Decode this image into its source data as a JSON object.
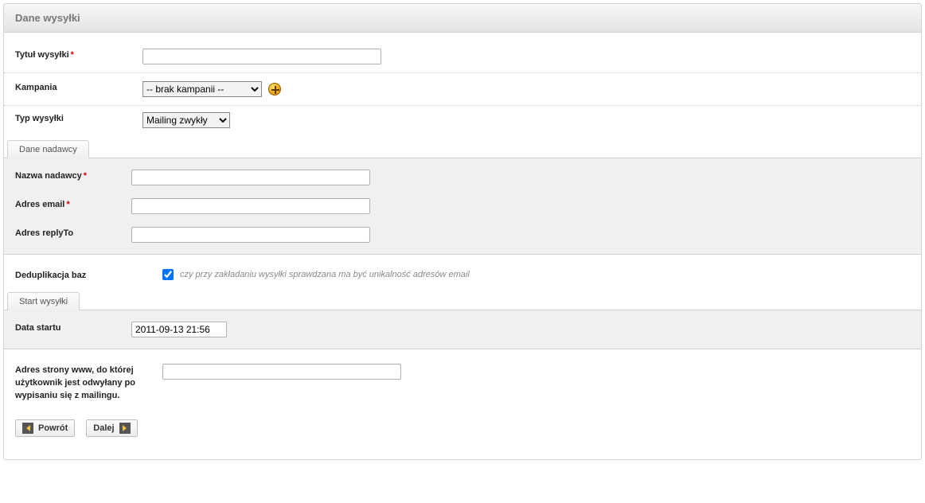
{
  "header": {
    "title": "Dane wysyłki"
  },
  "fields": {
    "title": {
      "label": "Tytuł wysyłki",
      "value": ""
    },
    "campaign": {
      "label": "Kampania",
      "selected": "-- brak kampanii --"
    },
    "type": {
      "label": "Typ wysyłki",
      "selected": "Mailing zwykły"
    },
    "dedup": {
      "label": "Deduplikacja baz",
      "checked": true,
      "hint": "czy przy zakładaniu wysyłki sprawdzana ma być unikalność adresów email"
    },
    "unsub_url": {
      "label": "Adres strony www, do której użytkownik jest odwyłany po wypisaniu się z mailingu.",
      "value": ""
    }
  },
  "sender": {
    "tab": "Dane nadawcy",
    "name": {
      "label": "Nazwa nadawcy",
      "value": ""
    },
    "email": {
      "label": "Adres email",
      "value": ""
    },
    "reply": {
      "label": "Adres replyTo",
      "value": ""
    }
  },
  "start": {
    "tab": "Start wysyłki",
    "date": {
      "label": "Data startu",
      "value": "2011-09-13 21:56"
    }
  },
  "buttons": {
    "back": "Powrót",
    "next": "Dalej"
  }
}
